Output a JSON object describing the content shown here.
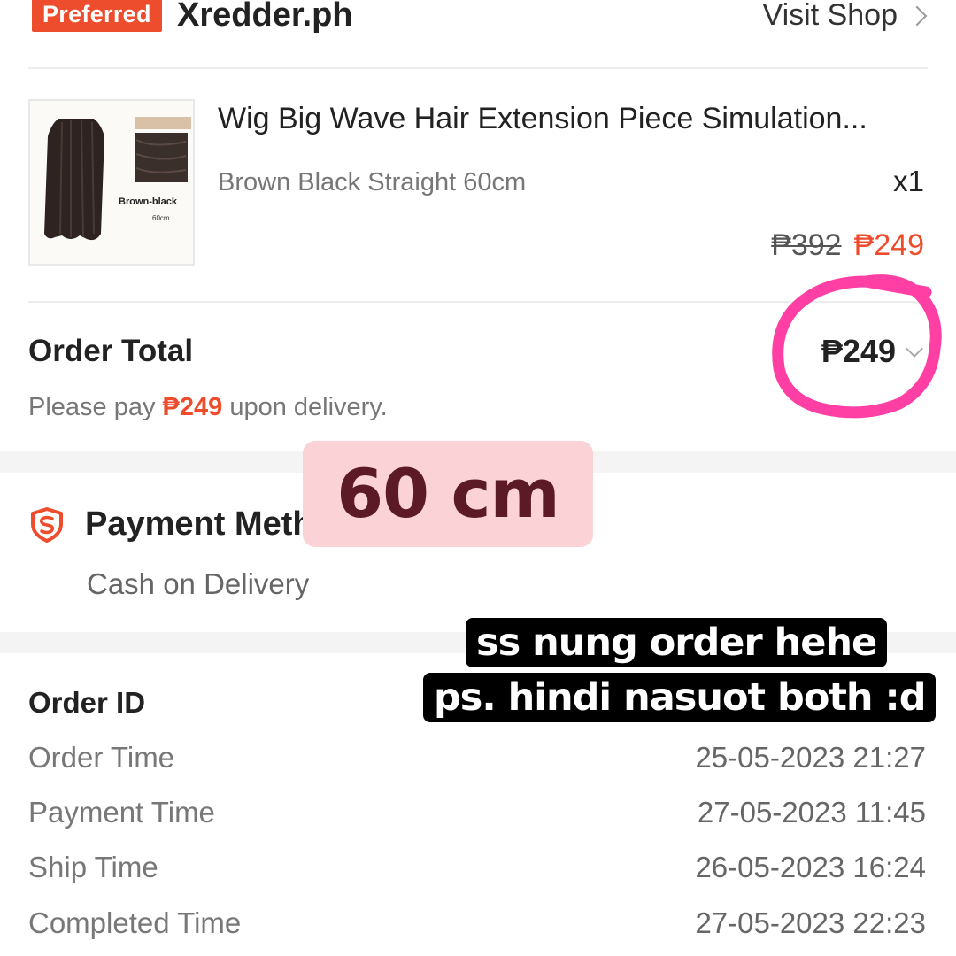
{
  "shop": {
    "badge": "Preferred",
    "name": "Xredder.ph",
    "visit_label": "Visit Shop"
  },
  "product": {
    "thumb_label": "Brown-black",
    "thumb_size": "60cm",
    "title": "Wig Big Wave Hair Extension Piece Simulation...",
    "variation": "Brown Black Straight 60cm",
    "quantity": "x1",
    "original_price": "₱392",
    "sale_price": "₱249"
  },
  "order_total": {
    "label": "Order Total",
    "value": "₱249",
    "note_prefix": "Please pay ",
    "note_amount": "₱249",
    "note_suffix": " upon delivery."
  },
  "payment": {
    "label": "Payment Method",
    "value": "Cash on Delivery"
  },
  "order_info": {
    "order_id_label": "Order ID",
    "rows": [
      {
        "label": "Order Time",
        "value": "25-05-2023 21:27"
      },
      {
        "label": "Payment Time",
        "value": "27-05-2023 11:45"
      },
      {
        "label": "Ship Time",
        "value": "26-05-2023 16:24"
      },
      {
        "label": "Completed Time",
        "value": "27-05-2023 22:23"
      }
    ]
  },
  "overlays": {
    "sticker": "60 cm",
    "caption_line1": "ss nung order hehe",
    "caption_line2": "ps. hindi nasuot both :d",
    "circle_color": "#ff3fa4"
  },
  "colors": {
    "accent": "#ee4d2d",
    "sticker_bg": "#fbd3d6",
    "sticker_text": "#5b1a26"
  }
}
